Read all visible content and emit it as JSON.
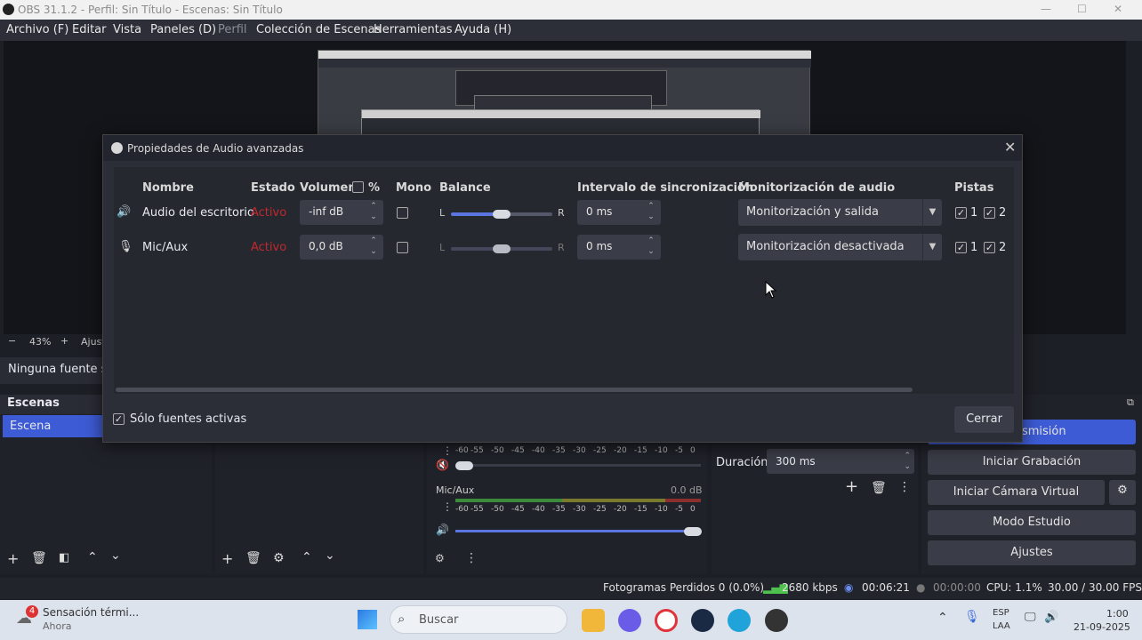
{
  "window": {
    "title": "OBS 31.1.2 - Perfil: Sin Título - Escenas: Sin Título"
  },
  "menu": [
    {
      "label": "Archivo (F)",
      "enabled": true
    },
    {
      "label": "Editar",
      "enabled": true
    },
    {
      "label": "Vista",
      "enabled": true
    },
    {
      "label": "Paneles (D)",
      "enabled": true
    },
    {
      "label": "Perfil",
      "enabled": false
    },
    {
      "label": "Colección de Escenas",
      "enabled": true
    },
    {
      "label": "Herramientas",
      "enabled": true
    },
    {
      "label": "Ayuda (H)",
      "enabled": true
    }
  ],
  "preview": {
    "zoom": "43%",
    "zoom_fit": "Ajust",
    "no_source": "Ninguna fuente sel"
  },
  "scenes": {
    "header": "Escenas",
    "items": [
      "Escena"
    ]
  },
  "mixer": {
    "ticks": [
      "-60",
      "-55",
      "-50",
      "-45",
      "-40",
      "-35",
      "-30",
      "-25",
      "-20",
      "-15",
      "-10",
      "-5",
      "0"
    ],
    "mic_label": "Mic/Aux",
    "mic_db": "0.0 dB"
  },
  "transitions": {
    "duration_label": "Duración",
    "duration_value": "300 ms"
  },
  "controls": {
    "stream": "Transmisión",
    "record": "Iniciar Grabación",
    "virtual_cam": "Iniciar Cámara Virtual",
    "studio": "Modo Estudio",
    "settings": "Ajustes"
  },
  "status": {
    "dropped": "Fotogramas Perdidos 0 (0.0%)",
    "bitrate": "2680 kbps",
    "stream_time": "00:06:21",
    "rec_time": "00:00:00",
    "cpu": "CPU: 1.1%",
    "fps": "30.00 / 30.00 FPS"
  },
  "dialog": {
    "title": "Propiedades de Audio avanzadas",
    "headers": {
      "name": "Nombre",
      "status": "Estado",
      "volume": "Volumen",
      "percent": "%",
      "mono": "Mono",
      "balance": "Balance",
      "sync": "Intervalo de sincronización",
      "monitoring": "Monitorización de audio",
      "tracks": "Pistas"
    },
    "rows": [
      {
        "name": "Audio del escritorio",
        "status": "Activo",
        "volume": "-inf dB",
        "mono": false,
        "balance_left": "L",
        "balance_right": "R",
        "balance": 0.5,
        "sync": "0 ms",
        "monitoring": "Monitorización y salida",
        "track1": "1",
        "track2": "2"
      },
      {
        "name": "Mic/Aux",
        "status": "Activo",
        "volume": "0,0 dB",
        "mono": false,
        "balance_left": "L",
        "balance_right": "R",
        "balance": 0.5,
        "sync": "0 ms",
        "monitoring": "Monitorización desactivada",
        "track1": "1",
        "track2": "2"
      }
    ],
    "active_only_label": "Sólo fuentes activas",
    "close_button": "Cerrar"
  },
  "taskbar": {
    "weather_badge": "4",
    "weather_title": "Sensación térmi...",
    "weather_sub": "Ahora",
    "search": "Buscar",
    "lang1": "ESP",
    "lang2": "LAA",
    "time": "1:00",
    "date": "21-09-2025"
  },
  "colors": {
    "accent": "#3d5bd4",
    "active_status": "#c0282d",
    "dialog_bg": "#2b2d37"
  }
}
